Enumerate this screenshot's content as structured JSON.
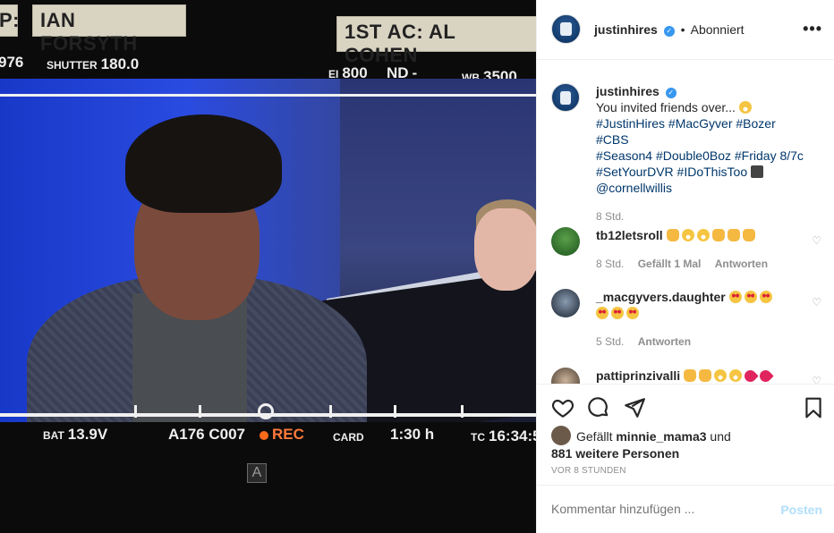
{
  "photo": {
    "cam_slate": "P:",
    "operator_slate": "IAN FORSYTH",
    "ac_slate": "1ST AC: AL COHEN",
    "top_left_value": "976",
    "shutter_label": "SHUTTER",
    "shutter_value": "180.0",
    "ei_label": "EI",
    "ei_value": "800",
    "nd_label": "ND",
    "nd_value": "-",
    "wb_label": "WB",
    "wb_value": "3500",
    "bat_label": "BAT",
    "bat_value": "13.9V",
    "clip": "A176 C007",
    "rec_label": "REC",
    "card_label": "CARD",
    "card_time": "1:30 h",
    "tc_label": "TC",
    "tc_value": "16:34:5",
    "badge": "A"
  },
  "header": {
    "username": "justinhires",
    "verified_icon": "check",
    "follow_status": "Abonniert",
    "more_icon": "•••"
  },
  "caption": {
    "username": "justinhires",
    "text": "You invited friends over...",
    "hashtags_line1": "#JustinHires #MacGyver #Bozer #CBS",
    "hashtags_line2": "#Season4 #Double0Boz #Friday 8/7c",
    "hashtags_line3": "#SetYourDVR #IDoThisToo",
    "mention": "@cornellwillis",
    "time": "8 Std."
  },
  "comments": [
    {
      "username": "tb12letsroll",
      "time": "8 Std.",
      "likes": "Gefällt 1 Mal",
      "reply": "Antworten"
    },
    {
      "username": "_macgyvers.daughter",
      "time": "5 Std.",
      "reply": "Antworten"
    },
    {
      "username": "pattiprinzivalli"
    }
  ],
  "actions": {
    "like_icon": "heart-icon",
    "comment_icon": "comment-icon",
    "share_icon": "share-icon",
    "save_icon": "bookmark-icon",
    "liked_by_prefix": "Gefällt",
    "liked_by_user": "minnie_mama3",
    "liked_by_and": "und",
    "liked_by_others": "881 weitere Personen",
    "timestamp": "VOR 8 STUNDEN"
  },
  "composer": {
    "placeholder": "Kommentar hinzufügen ...",
    "post_label": "Posten"
  },
  "colors": {
    "link": "#00376b",
    "verified": "#3897f0",
    "post_disabled": "#b2dffc",
    "rec": "#ff6a1a"
  }
}
